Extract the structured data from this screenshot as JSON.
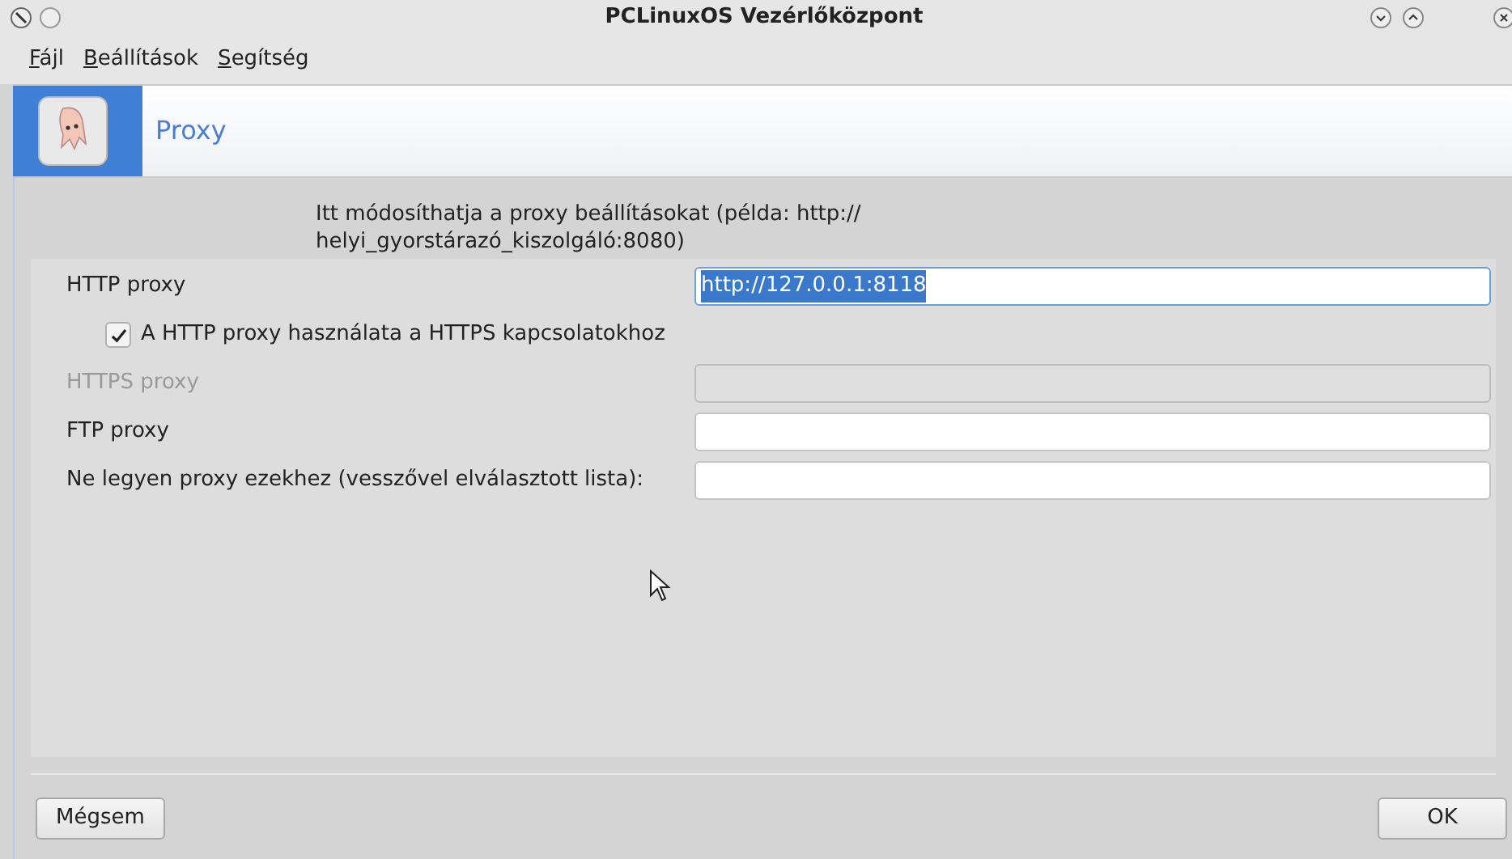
{
  "window": {
    "title": "PCLinuxOS Vezérlőközpont"
  },
  "menu": [
    {
      "label": "Fájl"
    },
    {
      "label": "Beállítások"
    },
    {
      "label": "Segítség"
    }
  ],
  "header": {
    "title": "Proxy"
  },
  "description": "Itt módosíthatja a proxy beállításokat (példa: http://\nhelyi_gyorstárazó_kiszolgáló:8080)",
  "rows": [
    {
      "kind": "field",
      "label": "HTTP proxy",
      "value": "http://127.0.0.1:8118",
      "disabled": false,
      "selected": true
    },
    {
      "kind": "checkbox",
      "label": "A HTTP proxy használata a HTTPS kapcsolatokhoz",
      "checked": true
    },
    {
      "kind": "field",
      "label": "HTTPS proxy",
      "disabled": true,
      "selected": false
    },
    {
      "kind": "field",
      "label": "FTP proxy",
      "disabled": false,
      "selected": false
    },
    {
      "kind": "field",
      "label": "Ne legyen proxy ezekhez (vesszővel elválasztott lista):",
      "disabled": false,
      "selected": false
    }
  ],
  "buttons": [
    {
      "label": "Mégsem"
    },
    {
      "label": "OK"
    }
  ]
}
